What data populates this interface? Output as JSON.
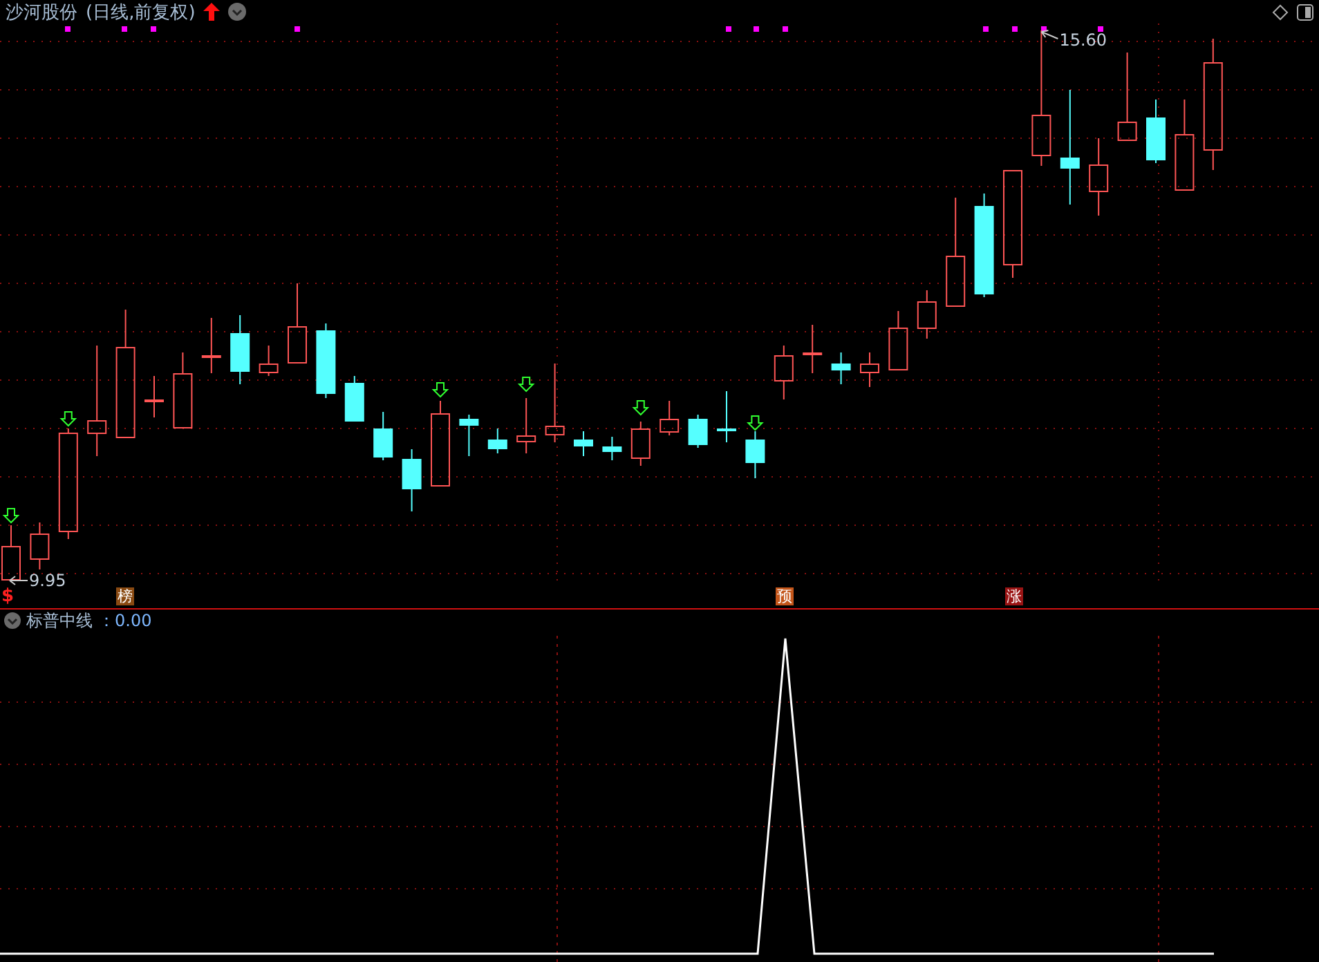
{
  "chart": {
    "title": "沙河股份",
    "period": "(日线,前复权)",
    "high_label": "15.60",
    "low_label": "9.95"
  },
  "signals": [
    {
      "kind": "text",
      "text": "$",
      "color": "#ff2020"
    },
    {
      "kind": "badge",
      "text": "榜",
      "color": "#8a4a12"
    },
    {
      "kind": "badge",
      "text": "预",
      "color": "#c4561a"
    },
    {
      "kind": "badge",
      "text": "涨",
      "color": "#9a1414"
    }
  ],
  "indicator": {
    "name": "标普中线",
    "value": "：0.00"
  }
}
